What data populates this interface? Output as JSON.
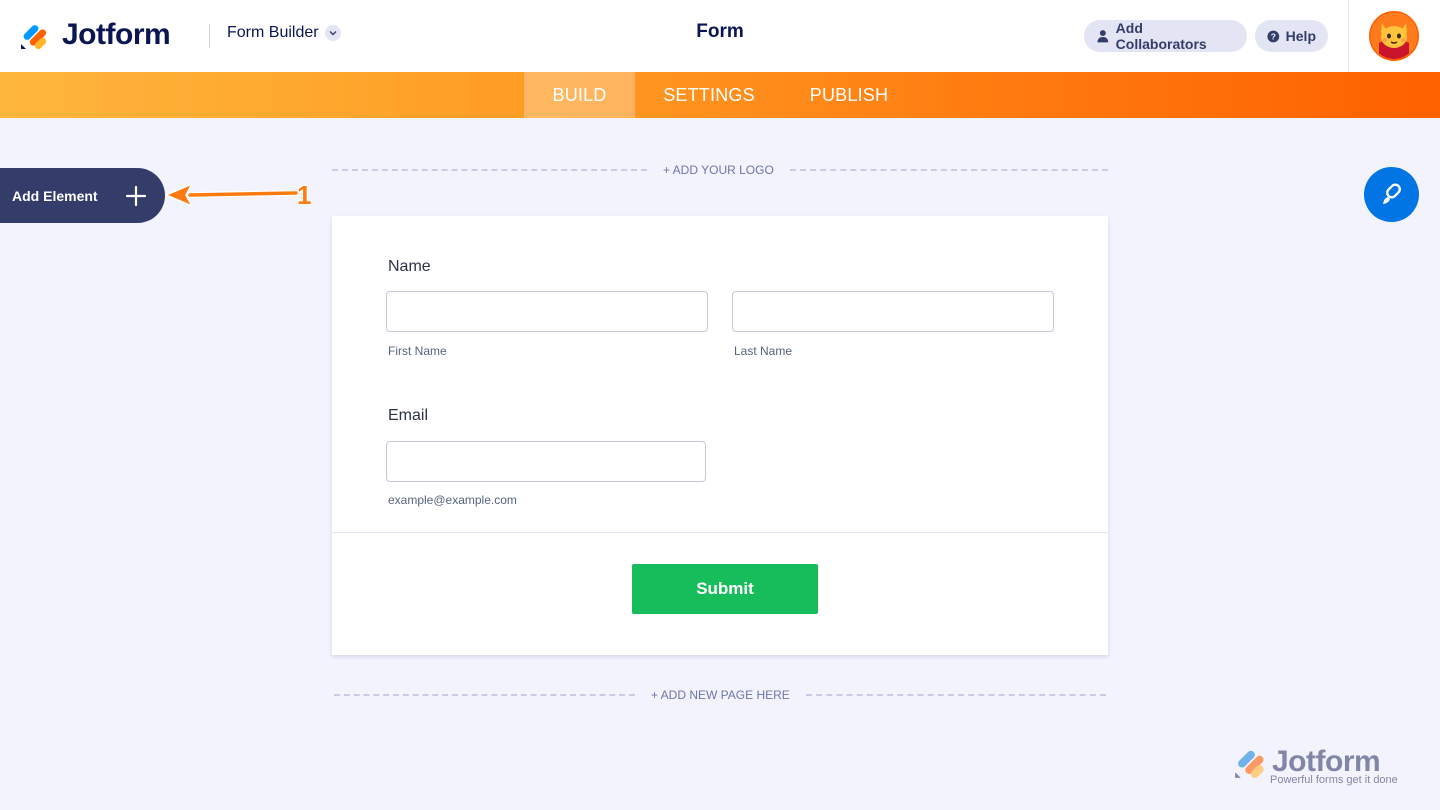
{
  "header": {
    "brand": "Jotform",
    "builder_menu": "Form Builder",
    "page_title": "Form",
    "add_collaborators": "Add Collaborators",
    "help": "Help"
  },
  "nav": {
    "tabs": [
      {
        "label": "BUILD",
        "active": true
      },
      {
        "label": "SETTINGS",
        "active": false
      },
      {
        "label": "PUBLISH",
        "active": false
      }
    ]
  },
  "sidebar": {
    "add_element": "Add Element"
  },
  "annotation": {
    "number": "1"
  },
  "canvas": {
    "add_logo": "+ ADD YOUR LOGO",
    "add_page": "+ ADD NEW PAGE HERE"
  },
  "form": {
    "name_label": "Name",
    "first_name_sub": "First Name",
    "last_name_sub": "Last Name",
    "email_label": "Email",
    "email_sub": "example@example.com",
    "submit": "Submit"
  },
  "watermark": {
    "name": "Jotform",
    "tagline": "Powerful forms get it done"
  },
  "colors": {
    "accent_orange": "#ff6100",
    "navy": "#0a1551",
    "submit_green": "#18bd5b",
    "designer_blue": "#0075e3"
  }
}
